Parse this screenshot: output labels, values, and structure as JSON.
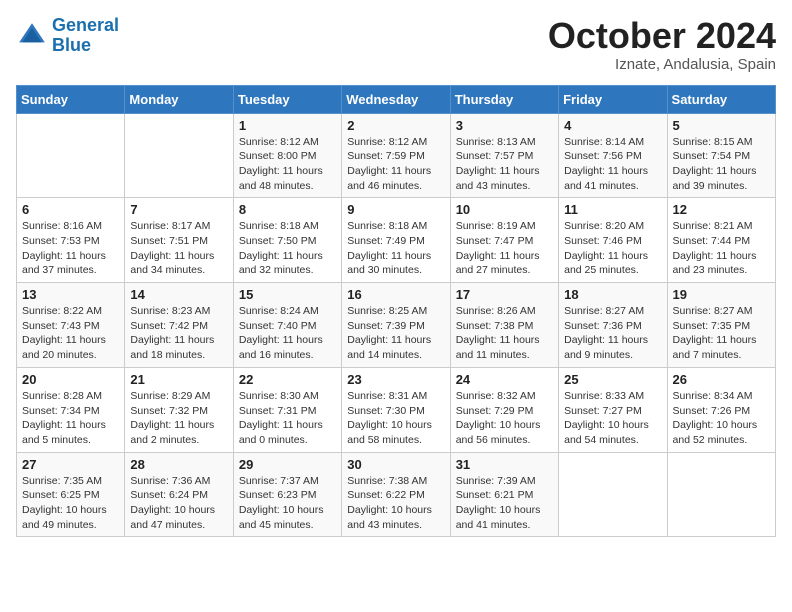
{
  "header": {
    "logo_line1": "General",
    "logo_line2": "Blue",
    "month": "October 2024",
    "location": "Iznate, Andalusia, Spain"
  },
  "days_of_week": [
    "Sunday",
    "Monday",
    "Tuesday",
    "Wednesday",
    "Thursday",
    "Friday",
    "Saturday"
  ],
  "weeks": [
    [
      {
        "day": "",
        "sunrise": "",
        "sunset": "",
        "daylight": ""
      },
      {
        "day": "",
        "sunrise": "",
        "sunset": "",
        "daylight": ""
      },
      {
        "day": "1",
        "sunrise": "Sunrise: 8:12 AM",
        "sunset": "Sunset: 8:00 PM",
        "daylight": "Daylight: 11 hours and 48 minutes."
      },
      {
        "day": "2",
        "sunrise": "Sunrise: 8:12 AM",
        "sunset": "Sunset: 7:59 PM",
        "daylight": "Daylight: 11 hours and 46 minutes."
      },
      {
        "day": "3",
        "sunrise": "Sunrise: 8:13 AM",
        "sunset": "Sunset: 7:57 PM",
        "daylight": "Daylight: 11 hours and 43 minutes."
      },
      {
        "day": "4",
        "sunrise": "Sunrise: 8:14 AM",
        "sunset": "Sunset: 7:56 PM",
        "daylight": "Daylight: 11 hours and 41 minutes."
      },
      {
        "day": "5",
        "sunrise": "Sunrise: 8:15 AM",
        "sunset": "Sunset: 7:54 PM",
        "daylight": "Daylight: 11 hours and 39 minutes."
      }
    ],
    [
      {
        "day": "6",
        "sunrise": "Sunrise: 8:16 AM",
        "sunset": "Sunset: 7:53 PM",
        "daylight": "Daylight: 11 hours and 37 minutes."
      },
      {
        "day": "7",
        "sunrise": "Sunrise: 8:17 AM",
        "sunset": "Sunset: 7:51 PM",
        "daylight": "Daylight: 11 hours and 34 minutes."
      },
      {
        "day": "8",
        "sunrise": "Sunrise: 8:18 AM",
        "sunset": "Sunset: 7:50 PM",
        "daylight": "Daylight: 11 hours and 32 minutes."
      },
      {
        "day": "9",
        "sunrise": "Sunrise: 8:18 AM",
        "sunset": "Sunset: 7:49 PM",
        "daylight": "Daylight: 11 hours and 30 minutes."
      },
      {
        "day": "10",
        "sunrise": "Sunrise: 8:19 AM",
        "sunset": "Sunset: 7:47 PM",
        "daylight": "Daylight: 11 hours and 27 minutes."
      },
      {
        "day": "11",
        "sunrise": "Sunrise: 8:20 AM",
        "sunset": "Sunset: 7:46 PM",
        "daylight": "Daylight: 11 hours and 25 minutes."
      },
      {
        "day": "12",
        "sunrise": "Sunrise: 8:21 AM",
        "sunset": "Sunset: 7:44 PM",
        "daylight": "Daylight: 11 hours and 23 minutes."
      }
    ],
    [
      {
        "day": "13",
        "sunrise": "Sunrise: 8:22 AM",
        "sunset": "Sunset: 7:43 PM",
        "daylight": "Daylight: 11 hours and 20 minutes."
      },
      {
        "day": "14",
        "sunrise": "Sunrise: 8:23 AM",
        "sunset": "Sunset: 7:42 PM",
        "daylight": "Daylight: 11 hours and 18 minutes."
      },
      {
        "day": "15",
        "sunrise": "Sunrise: 8:24 AM",
        "sunset": "Sunset: 7:40 PM",
        "daylight": "Daylight: 11 hours and 16 minutes."
      },
      {
        "day": "16",
        "sunrise": "Sunrise: 8:25 AM",
        "sunset": "Sunset: 7:39 PM",
        "daylight": "Daylight: 11 hours and 14 minutes."
      },
      {
        "day": "17",
        "sunrise": "Sunrise: 8:26 AM",
        "sunset": "Sunset: 7:38 PM",
        "daylight": "Daylight: 11 hours and 11 minutes."
      },
      {
        "day": "18",
        "sunrise": "Sunrise: 8:27 AM",
        "sunset": "Sunset: 7:36 PM",
        "daylight": "Daylight: 11 hours and 9 minutes."
      },
      {
        "day": "19",
        "sunrise": "Sunrise: 8:27 AM",
        "sunset": "Sunset: 7:35 PM",
        "daylight": "Daylight: 11 hours and 7 minutes."
      }
    ],
    [
      {
        "day": "20",
        "sunrise": "Sunrise: 8:28 AM",
        "sunset": "Sunset: 7:34 PM",
        "daylight": "Daylight: 11 hours and 5 minutes."
      },
      {
        "day": "21",
        "sunrise": "Sunrise: 8:29 AM",
        "sunset": "Sunset: 7:32 PM",
        "daylight": "Daylight: 11 hours and 2 minutes."
      },
      {
        "day": "22",
        "sunrise": "Sunrise: 8:30 AM",
        "sunset": "Sunset: 7:31 PM",
        "daylight": "Daylight: 11 hours and 0 minutes."
      },
      {
        "day": "23",
        "sunrise": "Sunrise: 8:31 AM",
        "sunset": "Sunset: 7:30 PM",
        "daylight": "Daylight: 10 hours and 58 minutes."
      },
      {
        "day": "24",
        "sunrise": "Sunrise: 8:32 AM",
        "sunset": "Sunset: 7:29 PM",
        "daylight": "Daylight: 10 hours and 56 minutes."
      },
      {
        "day": "25",
        "sunrise": "Sunrise: 8:33 AM",
        "sunset": "Sunset: 7:27 PM",
        "daylight": "Daylight: 10 hours and 54 minutes."
      },
      {
        "day": "26",
        "sunrise": "Sunrise: 8:34 AM",
        "sunset": "Sunset: 7:26 PM",
        "daylight": "Daylight: 10 hours and 52 minutes."
      }
    ],
    [
      {
        "day": "27",
        "sunrise": "Sunrise: 7:35 AM",
        "sunset": "Sunset: 6:25 PM",
        "daylight": "Daylight: 10 hours and 49 minutes."
      },
      {
        "day": "28",
        "sunrise": "Sunrise: 7:36 AM",
        "sunset": "Sunset: 6:24 PM",
        "daylight": "Daylight: 10 hours and 47 minutes."
      },
      {
        "day": "29",
        "sunrise": "Sunrise: 7:37 AM",
        "sunset": "Sunset: 6:23 PM",
        "daylight": "Daylight: 10 hours and 45 minutes."
      },
      {
        "day": "30",
        "sunrise": "Sunrise: 7:38 AM",
        "sunset": "Sunset: 6:22 PM",
        "daylight": "Daylight: 10 hours and 43 minutes."
      },
      {
        "day": "31",
        "sunrise": "Sunrise: 7:39 AM",
        "sunset": "Sunset: 6:21 PM",
        "daylight": "Daylight: 10 hours and 41 minutes."
      },
      {
        "day": "",
        "sunrise": "",
        "sunset": "",
        "daylight": ""
      },
      {
        "day": "",
        "sunrise": "",
        "sunset": "",
        "daylight": ""
      }
    ]
  ]
}
